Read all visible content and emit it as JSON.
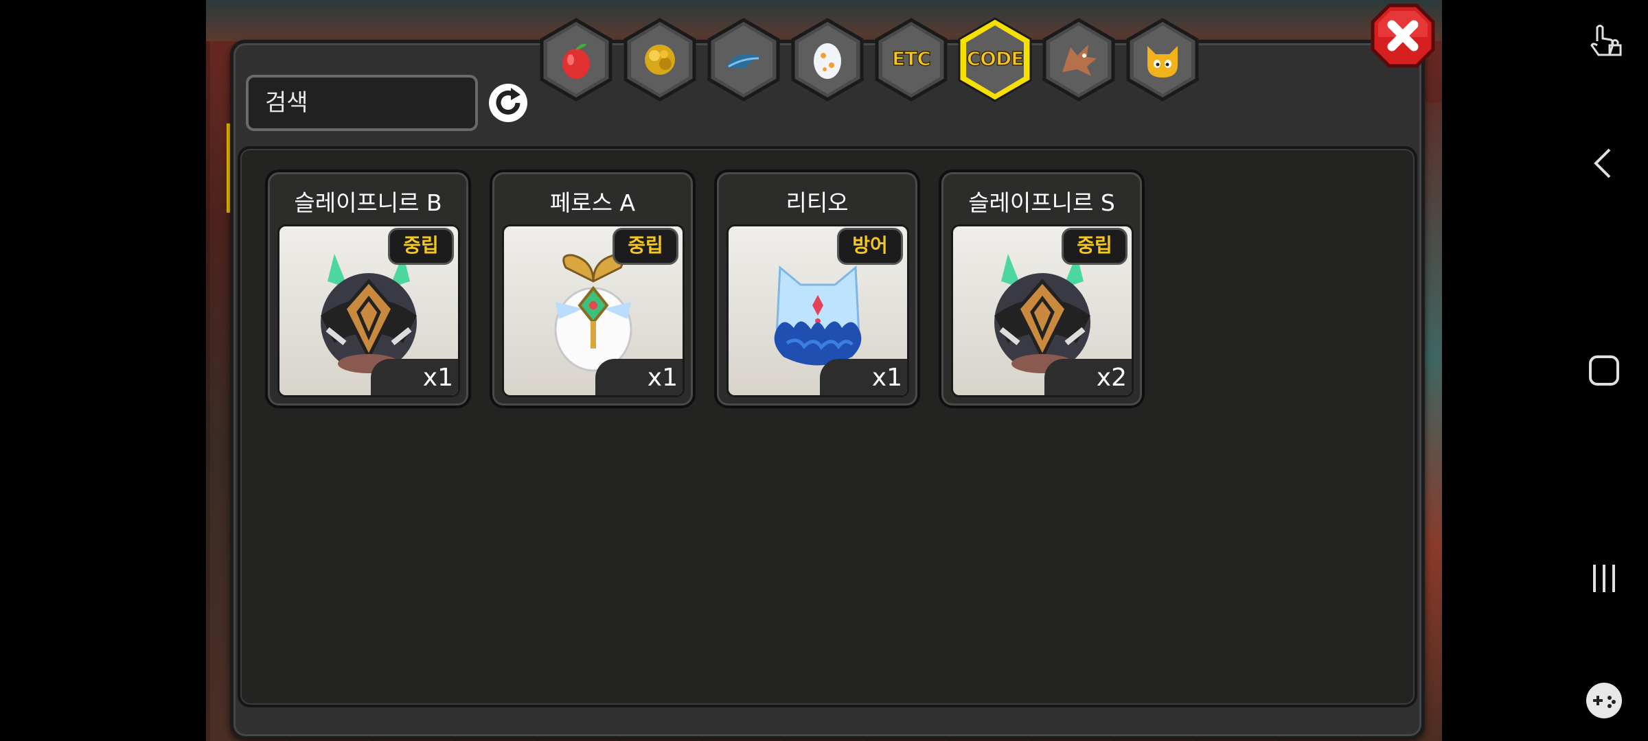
{
  "search": {
    "placeholder": "검색"
  },
  "tabs": [
    {
      "name": "fruit",
      "label": ""
    },
    {
      "name": "gold",
      "label": ""
    },
    {
      "name": "feather",
      "label": ""
    },
    {
      "name": "egg",
      "label": ""
    },
    {
      "name": "etc",
      "label": "ETC"
    },
    {
      "name": "code",
      "label": "CODE",
      "active": true
    },
    {
      "name": "dragon",
      "label": ""
    },
    {
      "name": "monster",
      "label": ""
    }
  ],
  "items": [
    {
      "title": "슬레이프니르 B",
      "badge": "중립",
      "quantity": "x1",
      "icon": "sleipnir-egg-icon"
    },
    {
      "title": "페로스 A",
      "badge": "중립",
      "quantity": "x1",
      "icon": "peros-egg-icon"
    },
    {
      "title": "리티오",
      "badge": "방어",
      "quantity": "x1",
      "icon": "ritio-egg-icon"
    },
    {
      "title": "슬레이프니르 S",
      "badge": "중립",
      "quantity": "x2",
      "icon": "sleipnir-egg-icon"
    }
  ],
  "colors": {
    "accent_yellow": "#f6c81e",
    "panel": "#303030",
    "close_red": "#d61f1f"
  }
}
